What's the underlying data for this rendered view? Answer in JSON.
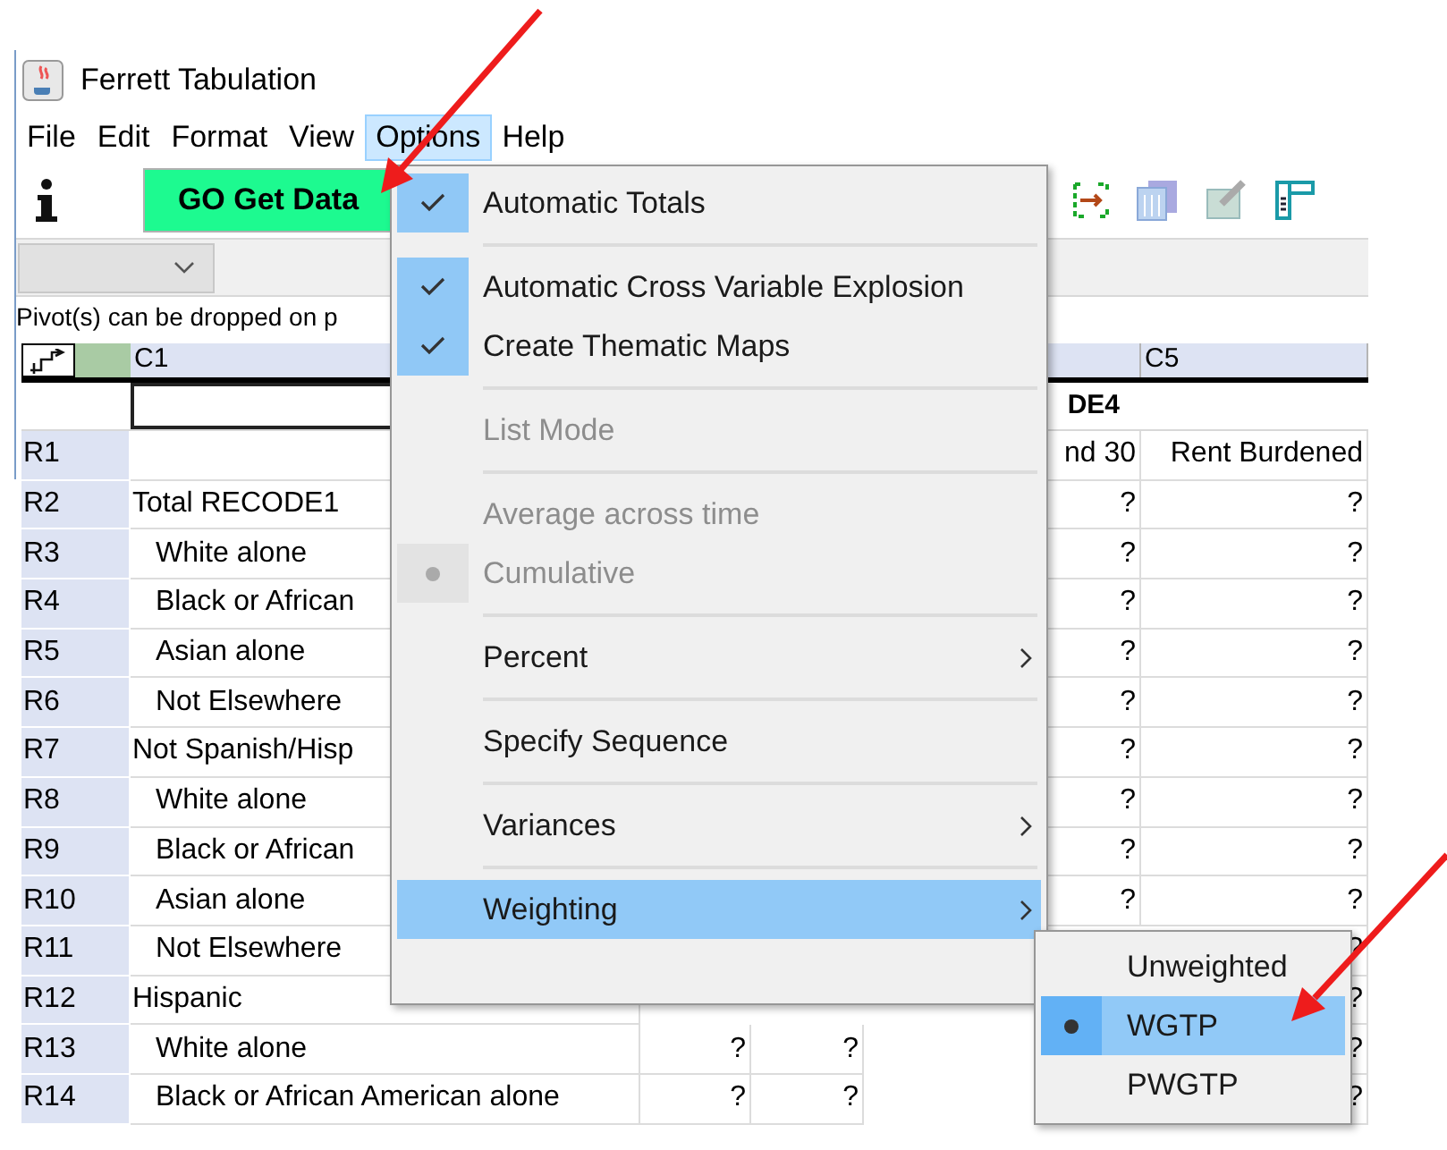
{
  "window": {
    "title": "Ferrett Tabulation"
  },
  "menu_bar": [
    {
      "label": "File",
      "selected": false
    },
    {
      "label": "Edit",
      "selected": false
    },
    {
      "label": "Format",
      "selected": false
    },
    {
      "label": "View",
      "selected": false
    },
    {
      "label": "Options",
      "selected": true
    },
    {
      "label": "Help",
      "selected": false
    }
  ],
  "toolbar": {
    "go_button": "GO Get Data"
  },
  "pivot_hint": "Pivot(s) can be dropped on p",
  "table": {
    "header": {
      "c1": "C1",
      "c5": "C5"
    },
    "variable_row": {
      "c4": "DE4"
    },
    "rows": [
      {
        "label": "R1",
        "c4": "nd 30",
        "c5": "Rent Burdened"
      },
      {
        "label": "R2",
        "c1": "Total RECODE1",
        "indented": false,
        "c4": "?",
        "c5": "?"
      },
      {
        "label": "R3",
        "c1": "White alone",
        "indented": true,
        "c4": "?",
        "c5": "?"
      },
      {
        "label": "R4",
        "c1": "Black or African",
        "indented": true,
        "c4": "?",
        "c5": "?"
      },
      {
        "label": "R5",
        "c1": "Asian alone",
        "indented": true,
        "c4": "?",
        "c5": "?"
      },
      {
        "label": "R6",
        "c1": "Not Elsewhere",
        "indented": true,
        "c4": "?",
        "c5": "?"
      },
      {
        "label": "R7",
        "c1": "Not Spanish/Hisp",
        "indented": false,
        "c4": "?",
        "c5": "?"
      },
      {
        "label": "R8",
        "c1": "White alone",
        "indented": true,
        "c4": "?",
        "c5": "?"
      },
      {
        "label": "R9",
        "c1": "Black or African",
        "indented": true,
        "c4": "?",
        "c5": "?"
      },
      {
        "label": "R10",
        "c1": "Asian alone",
        "indented": true,
        "c4": "?",
        "c5": "?"
      },
      {
        "label": "R11",
        "c1": "Not Elsewhere",
        "indented": true,
        "c5": "?"
      },
      {
        "label": "R12",
        "c1": "Hispanic",
        "indented": false,
        "c5": "?"
      },
      {
        "label": "R13",
        "c1": "White alone",
        "indented": true,
        "c2": "?",
        "c3": "?",
        "c5": "?"
      },
      {
        "label": "R14",
        "c1": "Black or African American alone",
        "indented": true,
        "c2": "?",
        "c3": "?",
        "c5": "?"
      }
    ]
  },
  "options_menu": [
    {
      "kind": "check",
      "label": "Automatic Totals",
      "checked": true,
      "disabled": false
    },
    {
      "kind": "separator"
    },
    {
      "kind": "check",
      "label": "Automatic Cross Variable Explosion",
      "checked": true,
      "disabled": false
    },
    {
      "kind": "check",
      "label": "Create Thematic Maps",
      "checked": true,
      "disabled": false
    },
    {
      "kind": "separator"
    },
    {
      "kind": "item",
      "label": "List Mode",
      "disabled": true
    },
    {
      "kind": "separator"
    },
    {
      "kind": "radio",
      "label": "Average across time",
      "checked": false,
      "disabled": true
    },
    {
      "kind": "radio",
      "label": "Cumulative",
      "checked": true,
      "disabled": true
    },
    {
      "kind": "separator"
    },
    {
      "kind": "submenu",
      "label": "Percent",
      "selected": false
    },
    {
      "kind": "separator"
    },
    {
      "kind": "item",
      "label": "Specify Sequence",
      "disabled": false
    },
    {
      "kind": "separator"
    },
    {
      "kind": "submenu",
      "label": "Variances",
      "selected": false
    },
    {
      "kind": "separator"
    },
    {
      "kind": "submenu",
      "label": "Weighting",
      "selected": true
    }
  ],
  "weighting_submenu": [
    {
      "label": "Unweighted",
      "selected": false
    },
    {
      "label": "WGTP",
      "selected": true
    },
    {
      "label": "PWGTP",
      "selected": false
    }
  ]
}
